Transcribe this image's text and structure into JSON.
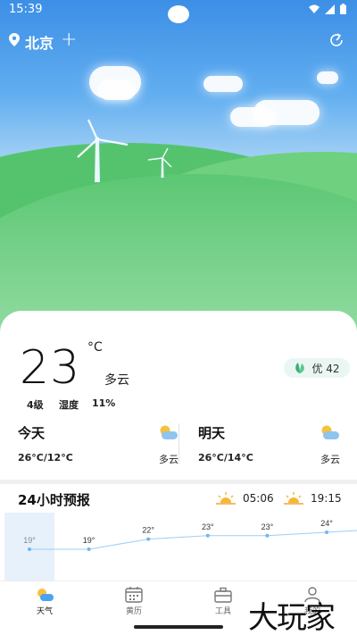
{
  "status_bar": {
    "time": "15:39"
  },
  "location": {
    "city": "北京",
    "add_symbol": "+"
  },
  "current": {
    "temperature": "23",
    "unit": "°C",
    "condition": "多云",
    "aqi_label": "优 42",
    "wind": "4级",
    "humidity_label": "湿度",
    "humidity_value": "11%"
  },
  "days": [
    {
      "name": "今天",
      "range": "26°C/12°C",
      "condition": "多云"
    },
    {
      "name": "明天",
      "range": "26°C/14°C",
      "condition": "多云"
    }
  ],
  "hourly_title": "24小时预报",
  "sunrise": "05:06",
  "sunset": "19:15",
  "hourly_temps": [
    "19°",
    "19°",
    "22°",
    "23°",
    "23°",
    "24°"
  ],
  "hourly_values": [
    19,
    19,
    22,
    23,
    23,
    24
  ],
  "tabs": [
    {
      "label": "天气",
      "icon": "weather-icon"
    },
    {
      "label": "黄历",
      "icon": "calendar-icon"
    },
    {
      "label": "工具",
      "icon": "toolbox-icon"
    },
    {
      "label": "我的",
      "icon": "profile-icon"
    }
  ],
  "watermark": "大玩家",
  "colors": {
    "accent_blue": "#4aa3f0",
    "sky": "#3c8fe6",
    "grass": "#5cc774"
  }
}
